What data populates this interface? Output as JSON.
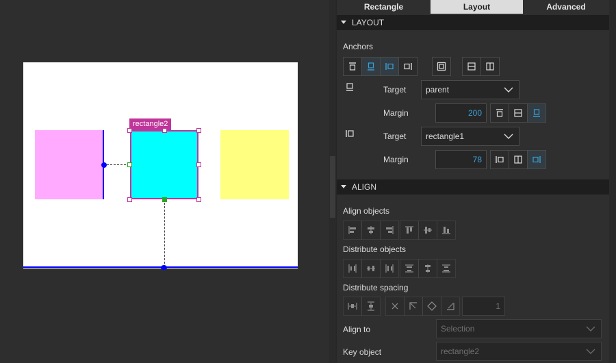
{
  "tabs": [
    {
      "label": "Rectangle",
      "active": false
    },
    {
      "label": "Layout",
      "active": true
    },
    {
      "label": "Advanced",
      "active": false
    }
  ],
  "canvas": {
    "selection_label": "rectangle2",
    "colors": {
      "rectangle1": "#ffaaff",
      "rectangle2": "#00ffff",
      "rectangle3": "#ffff80",
      "anchor": "#0000ff",
      "selection": "#c0359a"
    }
  },
  "layout": {
    "section_title": "LAYOUT",
    "anchors_label": "Anchors",
    "anchor_buttons": [
      {
        "icon": "anchor-top-icon",
        "on": false
      },
      {
        "icon": "anchor-bottom-icon",
        "on": true
      },
      {
        "icon": "anchor-left-icon",
        "on": true
      },
      {
        "icon": "anchor-right-icon",
        "on": false
      },
      {
        "icon": "anchor-fill-icon",
        "on": false
      },
      {
        "icon": "anchor-vertical-center-icon",
        "on": false
      },
      {
        "icon": "anchor-horizontal-center-icon",
        "on": false
      }
    ],
    "vertical": {
      "target_label": "Target",
      "target_value": "parent",
      "margin_label": "Margin",
      "margin_value": "200"
    },
    "horizontal": {
      "target_label": "Target",
      "target_value": "rectangle1",
      "margin_label": "Margin",
      "margin_value": "78"
    }
  },
  "align": {
    "section_title": "ALIGN",
    "align_objects_label": "Align objects",
    "distribute_objects_label": "Distribute objects",
    "distribute_spacing_label": "Distribute spacing",
    "spacing_value": "1",
    "align_to_label": "Align to",
    "align_to_value": "Selection",
    "key_object_label": "Key object",
    "key_object_value": "rectangle2"
  }
}
